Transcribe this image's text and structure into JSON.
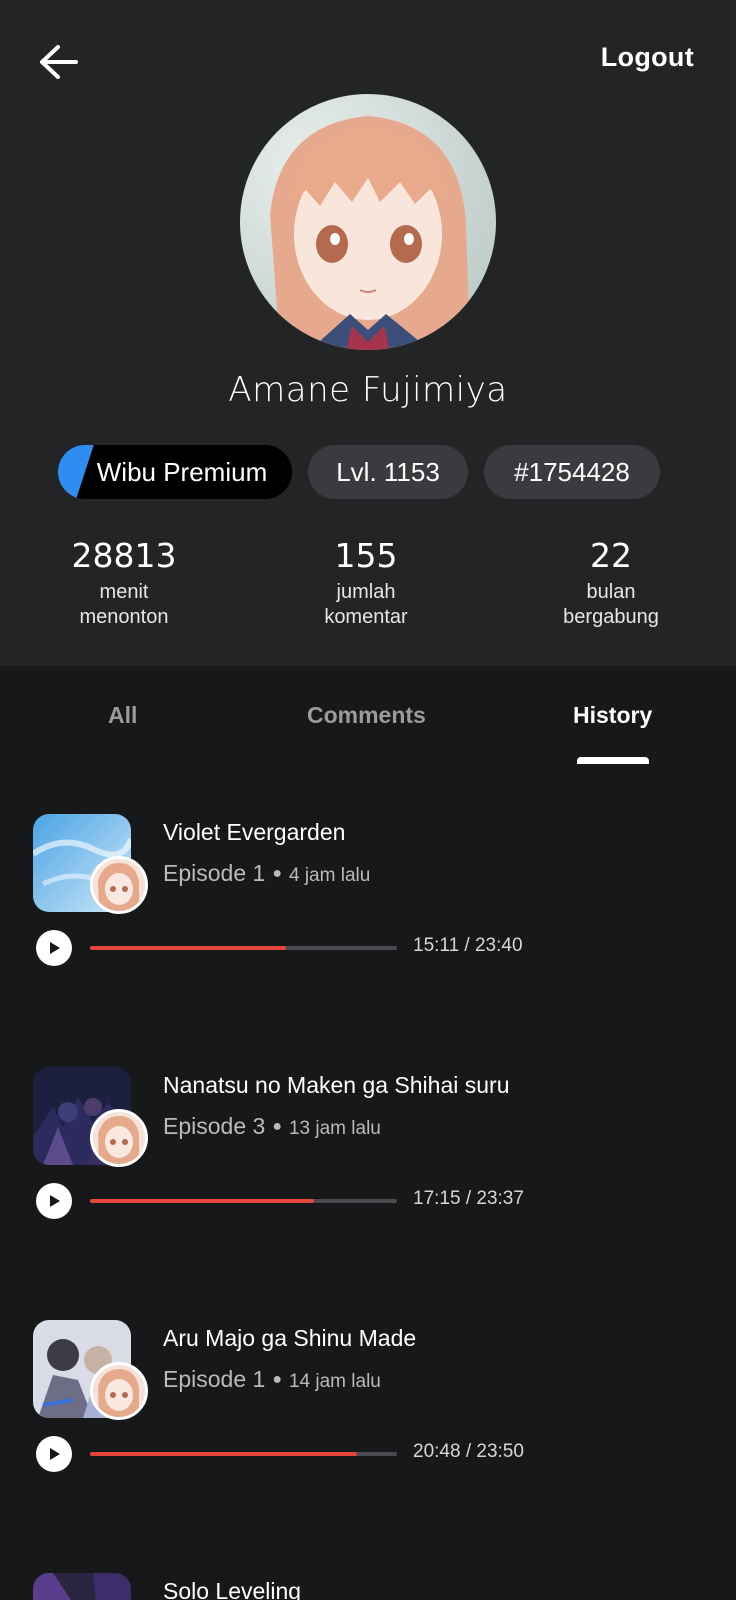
{
  "header": {
    "logout_label": "Logout",
    "username": "Amane Fujimiya",
    "badges": {
      "premium": "Wibu Premium",
      "level": "Lvl. 1153",
      "id": "#1754428"
    },
    "stats": [
      {
        "value": "28813",
        "label_line1": "menit",
        "label_line2": "menonton"
      },
      {
        "value": "155",
        "label_line1": "jumlah",
        "label_line2": "komentar"
      },
      {
        "value": "22",
        "label_line1": "bulan",
        "label_line2": "bergabung"
      }
    ]
  },
  "tabs": [
    {
      "label": "All",
      "active": false
    },
    {
      "label": "Comments",
      "active": false
    },
    {
      "label": "History",
      "active": true
    }
  ],
  "history": [
    {
      "title": "Violet Evergarden",
      "episode": "Episode 1",
      "ago": "4 jam lalu",
      "time": "15:11 / 23:40",
      "progress_fraction": 0.64
    },
    {
      "title": "Nanatsu no Maken ga Shihai suru",
      "episode": "Episode 3",
      "ago": "13 jam lalu",
      "time": "17:15 / 23:37",
      "progress_fraction": 0.73
    },
    {
      "title": "Aru Majo ga Shinu Made",
      "episode": "Episode 1",
      "ago": "14 jam lalu",
      "time": "20:48 / 23:50",
      "progress_fraction": 0.87
    },
    {
      "title": "Solo Leveling"
    }
  ],
  "colors": {
    "header_bg": "#232426",
    "page_bg": "#17181a",
    "premium_accent": "#2f8cf0",
    "progress_fill": "#e6453b"
  }
}
